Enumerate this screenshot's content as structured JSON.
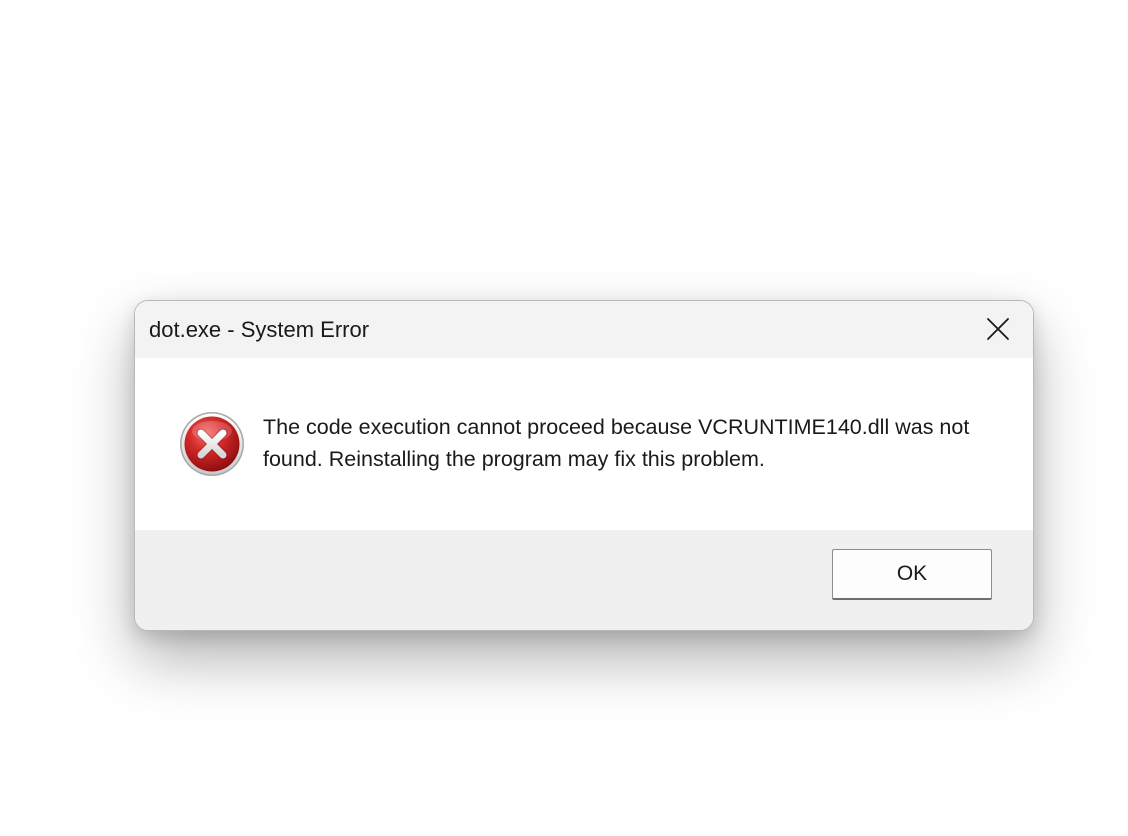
{
  "window": {
    "title": "dot.exe - System Error"
  },
  "titlebar": {
    "close_icon": "close-icon"
  },
  "content": {
    "icon": "error-icon",
    "message": "The code execution cannot proceed because VCRUNTIME140.dll was not found. Reinstalling the program may fix this problem."
  },
  "footer": {
    "ok_label": "OK"
  },
  "colors": {
    "titlebar_bg": "#f3f3f3",
    "content_bg": "#ffffff",
    "footer_bg": "#f0f0f0",
    "error_red": "#c8161d"
  }
}
